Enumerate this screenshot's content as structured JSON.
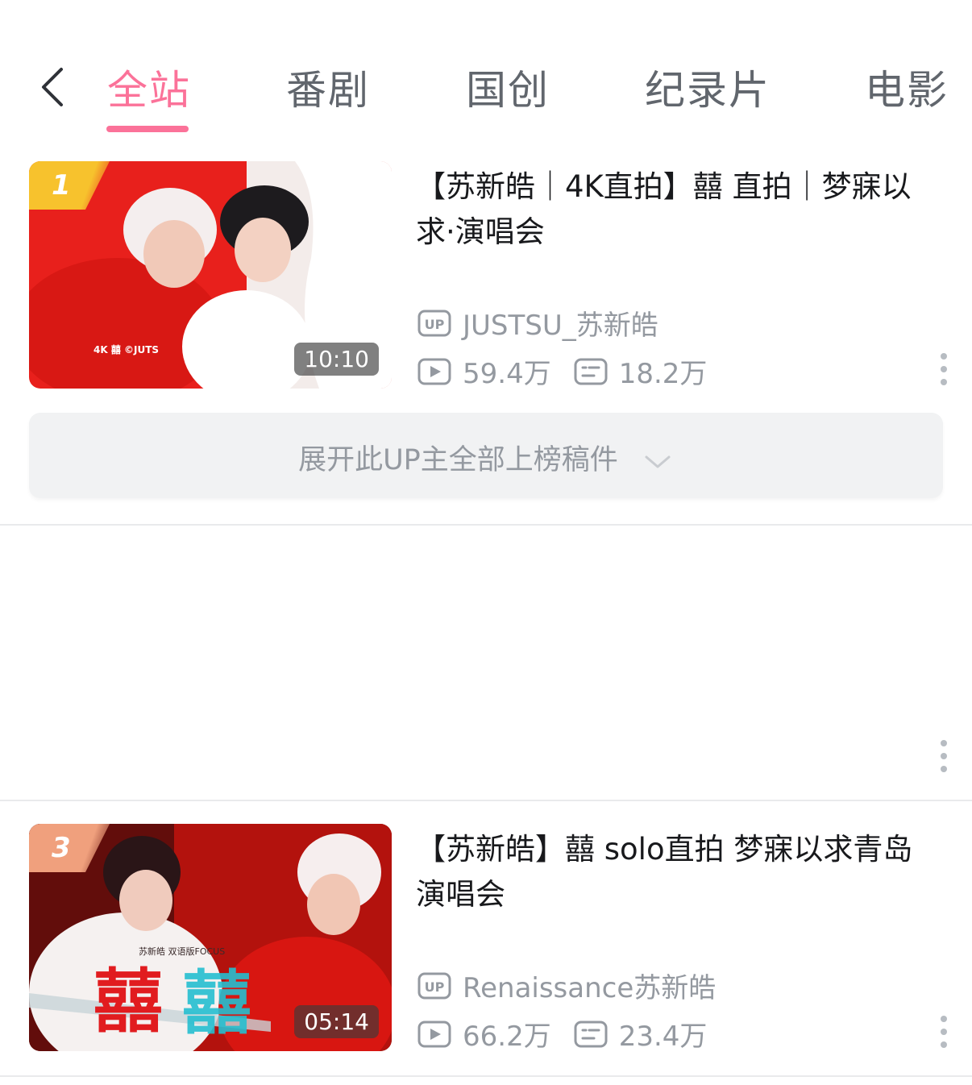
{
  "tabs": [
    {
      "label": "全站",
      "active": true
    },
    {
      "label": "番剧",
      "active": false
    },
    {
      "label": "国创",
      "active": false
    },
    {
      "label": "纪录片",
      "active": false
    },
    {
      "label": "电影",
      "active": false
    }
  ],
  "accent_color": "#fb7299",
  "videos": [
    {
      "rank": "1",
      "title": "【苏新皓｜4K直拍】囍 直拍｜梦寐以求·演唱会",
      "duration": "10:10",
      "uploader": "JUSTSU_苏新皓",
      "views": "59.4万",
      "danmaku": "18.2万"
    },
    {
      "rank": "3",
      "title": "【苏新皓】囍 solo直拍 梦寐以求青岛演唱会",
      "duration": "05:14",
      "uploader": "Renaissance苏新皓",
      "views": "66.2万",
      "danmaku": "23.4万"
    }
  ],
  "expand_label": "展开此UP主全部上榜稿件",
  "thumb_text": {
    "v1_watermark": "4K    囍    ©JUTS",
    "v2_caption": "苏新皓 双语版FOCUS",
    "v2_logo": "囍"
  }
}
